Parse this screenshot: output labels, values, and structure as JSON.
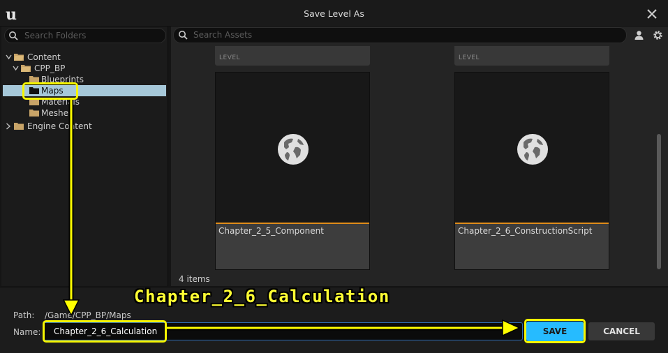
{
  "window": {
    "title": "Save Level As"
  },
  "folders": {
    "search_placeholder": "Search Folders",
    "tree": [
      {
        "label": "Content"
      },
      {
        "label": "CPP_BP"
      },
      {
        "label": "Blueprints"
      },
      {
        "label": "Maps",
        "selected": true
      },
      {
        "label": "Materials"
      },
      {
        "label": "Meshes"
      },
      {
        "label": "Engine Content"
      }
    ]
  },
  "assets": {
    "search_placeholder": "Search Assets",
    "partial_tiles": [
      {
        "type": "LEVEL"
      },
      {
        "type": "LEVEL"
      }
    ],
    "tiles": [
      {
        "name": "Chapter_2_5_Component",
        "icon": "level-globe-icon"
      },
      {
        "name": "Chapter_2_6_ConstructionScript",
        "icon": "level-globe-icon"
      }
    ],
    "count_text": "4 items"
  },
  "footer": {
    "path_label": "Path:",
    "path_value": "/Game/CPP_BP/Maps",
    "name_label": "Name:",
    "name_value": "Chapter_2_6_Calculation",
    "save_label": "SAVE",
    "cancel_label": "CANCEL"
  },
  "annotation": {
    "text": "Chapter_2_6_Calculation",
    "color": "#ffff00"
  },
  "colors": {
    "accent": "#26bbff",
    "selection": "#a6c8d9",
    "tile_stripe": "#e08c1a",
    "folder": "#c8a468"
  }
}
